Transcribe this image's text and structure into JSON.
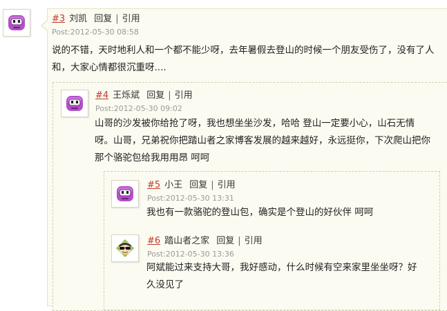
{
  "comments": [
    {
      "floor": "#3",
      "user": "刘凯",
      "reply": "回复",
      "sep": "|",
      "quote": "引用",
      "post": "Post:2012-05-30 08:58",
      "lines": [
        "说的不错，天时地利人和一个都不能少呀，去年暑假去登山的时候一个朋友受伤了，没有了人",
        "和，大家心情都很沉重呀...."
      ],
      "avatar": "purple-face"
    },
    {
      "floor": "#4",
      "user": "王烁斌",
      "reply": "回复",
      "sep": "|",
      "quote": "引用",
      "post": "Post:2012-05-30 09:02",
      "lines": [
        "山哥的沙发被你给抢了呀，我也想坐坐沙发，哈哈 登山一定要小心，山石无情",
        "呀。山哥，兄弟祝你把踏山者之家博客发展的越来越好，永远挺你，下次爬山把你",
        "那个骆驼包给我用用昂 呵呵"
      ],
      "avatar": "purple-face"
    },
    {
      "floor": "#5",
      "user": "小王",
      "reply": "回复",
      "sep": "|",
      "quote": "引用",
      "post": "Post:2012-05-30 13:31",
      "lines": [
        "我也有一款骆驼的登山包，确实是个登山的好伙伴 呵呵"
      ],
      "avatar": "purple-face"
    },
    {
      "floor": "#6",
      "user": "踏山者之家",
      "reply": "回复",
      "sep": "|",
      "quote": "引用",
      "post": "Post:2012-05-30 13:36",
      "lines": [
        "阿斌能过来支持大哥，我好感动，什么时候有空来家里坐坐呀？好",
        "久没见了"
      ],
      "avatar": "sunglasses-face"
    }
  ],
  "colors": {
    "floor": "#c0392b",
    "panel": "#fbfbf1",
    "border": "#e4e4c9",
    "post": "#999999"
  }
}
